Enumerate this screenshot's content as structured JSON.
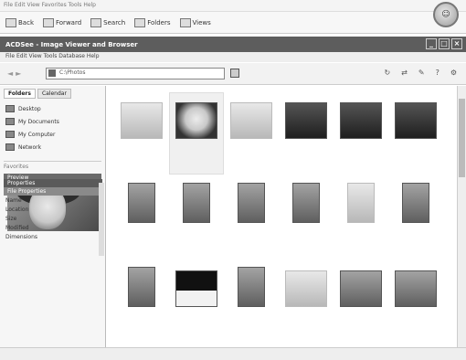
{
  "host": {
    "menu_text": "File  Edit  View  Favorites  Tools  Help",
    "toolbar_items": [
      "Back",
      "Forward",
      "Search",
      "Folders",
      "Views"
    ],
    "avatar_glyph": "☺"
  },
  "window": {
    "title": "ACDSee - Image Viewer and Browser",
    "menu_text": "File  Edit  View  Tools  Database  Help",
    "controls": [
      "_",
      "□",
      "×"
    ]
  },
  "address": {
    "value": "C:\\Photos",
    "right_tools": [
      "↻",
      "⇄",
      "✎",
      "?",
      "⚙"
    ]
  },
  "left_pane": {
    "tabs": [
      "Folders",
      "Calendar"
    ],
    "folders": [
      "Desktop",
      "My Documents",
      "My Computer",
      "Network"
    ],
    "tree_footer": "Favorites",
    "preview_label": "Preview",
    "props_header": "Properties",
    "props_subheader": "File Properties",
    "props": [
      "Name",
      "Location",
      "Size",
      "Modified",
      "Dimensions"
    ]
  },
  "grid": {
    "tiles": [
      {
        "style": "light",
        "portrait": false,
        "name": "",
        "size": "",
        "selected": false
      },
      {
        "style": "face",
        "portrait": false,
        "name": "",
        "size": "",
        "selected": true
      },
      {
        "style": "light",
        "portrait": false,
        "name": "",
        "size": "",
        "selected": false
      },
      {
        "style": "dark",
        "portrait": false,
        "name": "",
        "size": "",
        "selected": false
      },
      {
        "style": "dark",
        "portrait": false,
        "name": "",
        "size": "",
        "selected": false
      },
      {
        "style": "dark",
        "portrait": false,
        "name": "",
        "size": "",
        "selected": false
      },
      {
        "style": "mid",
        "portrait": true,
        "name": "",
        "size": "",
        "selected": false
      },
      {
        "style": "mid",
        "portrait": true,
        "name": "",
        "size": "",
        "selected": false
      },
      {
        "style": "mid",
        "portrait": true,
        "name": "",
        "size": "",
        "selected": false
      },
      {
        "style": "mid",
        "portrait": true,
        "name": "",
        "size": "",
        "selected": false
      },
      {
        "style": "light",
        "portrait": true,
        "name": "",
        "size": "",
        "selected": false
      },
      {
        "style": "mid",
        "portrait": true,
        "name": "",
        "size": "",
        "selected": false
      },
      {
        "style": "mid",
        "portrait": true,
        "name": "",
        "size": "",
        "selected": false
      },
      {
        "style": "split",
        "portrait": false,
        "name": "",
        "size": "",
        "selected": false
      },
      {
        "style": "mid",
        "portrait": true,
        "name": "",
        "size": "",
        "selected": false
      },
      {
        "style": "light",
        "portrait": false,
        "name": "",
        "size": "",
        "selected": false
      },
      {
        "style": "mid",
        "portrait": false,
        "name": "",
        "size": "",
        "selected": false
      },
      {
        "style": "mid",
        "portrait": false,
        "name": "",
        "size": "",
        "selected": false
      }
    ]
  },
  "status": {
    "left": "",
    "right": [
      "",
      "",
      ""
    ]
  }
}
